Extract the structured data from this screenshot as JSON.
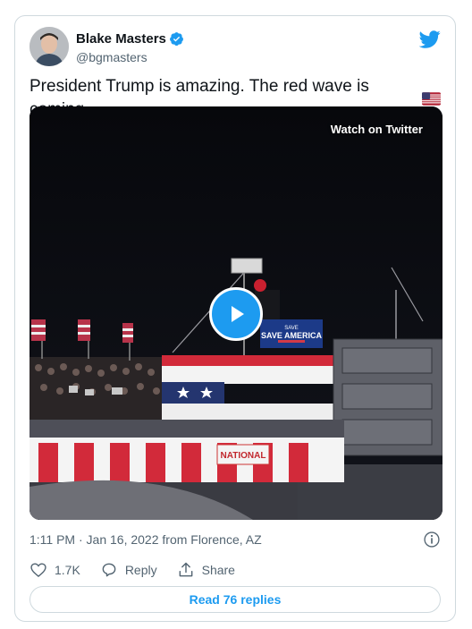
{
  "author": {
    "name": "Blake Masters",
    "handle": "@bgmasters"
  },
  "tweet": {
    "text": "President Trump is amazing. The red wave is coming."
  },
  "media": {
    "watch_label": "Watch on Twitter",
    "stage_sign": "SAVE AMERICA",
    "banner": "NATIONAL"
  },
  "meta": {
    "timestamp": "1:11 PM · Jan 16, 2022 from Florence, AZ"
  },
  "actions": {
    "likes": "1.7K",
    "reply_label": "Reply",
    "share_label": "Share"
  },
  "replies_button": "Read 76 replies",
  "colors": {
    "accent": "#1d9bf0",
    "text": "#0f1419",
    "muted": "#536471",
    "border": "#cfd9de"
  }
}
